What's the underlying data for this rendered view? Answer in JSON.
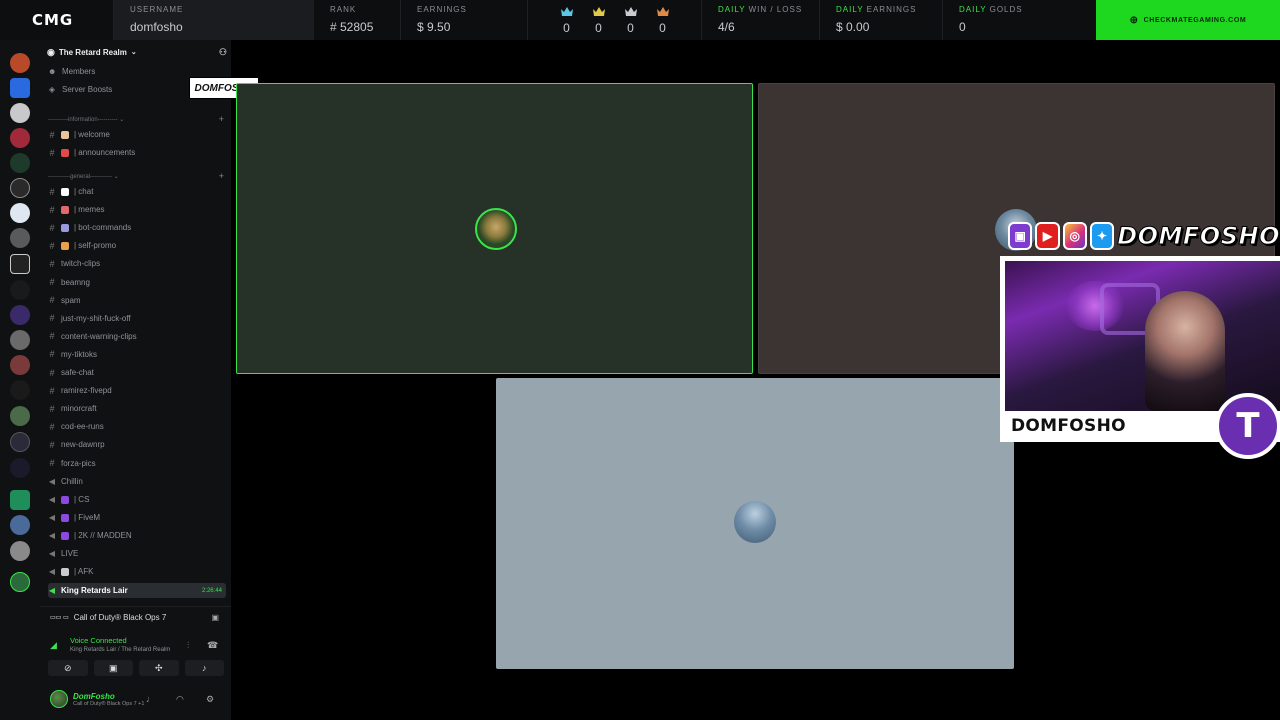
{
  "topbar": {
    "logo": "CMG",
    "username_label": "USERNAME",
    "username": "domfosho",
    "rank_label": "RANK",
    "rank": "# 52805",
    "earnings_label": "EARNINGS",
    "earnings": "$ 9.50",
    "crowns": [
      {
        "color": "#5cc6e6",
        "count": "0"
      },
      {
        "color": "#e2c84a",
        "count": "0"
      },
      {
        "color": "#c9ccd0",
        "count": "0"
      },
      {
        "color": "#e08a4a",
        "count": "0"
      }
    ],
    "daily_wl_label_1": "DAILY",
    "daily_wl_label_2": " WIN / LOSS",
    "daily_wl": "4/6",
    "daily_earnings_label_1": "DAILY",
    "daily_earnings_label_2": " EARNINGS",
    "daily_earnings": "$ 0.00",
    "daily_golds_label_1": "DAILY",
    "daily_golds_label_2": " GOLDS",
    "daily_golds": "0",
    "site_button": "CHECKMATEGAMING.COM"
  },
  "server": {
    "name": "The Retard Realm",
    "members": "Members",
    "boosts": "Server Boosts",
    "category_info": "----------information---------- ⌄",
    "category_general": "-----------general----------- ⌄",
    "channels_info": [
      {
        "name": "| welcome",
        "emoji_color": "#e8c49a"
      },
      {
        "name": "| announcements",
        "emoji_color": "#e04a4a"
      }
    ],
    "channels_general": [
      {
        "name": "| chat",
        "emoji_color": "#ffffff",
        "type": "text"
      },
      {
        "name": "| memes",
        "emoji_color": "#e06a6a",
        "type": "text"
      },
      {
        "name": "| bot-commands",
        "emoji_color": "#9a9ae0",
        "type": "text"
      },
      {
        "name": "| self-promo",
        "emoji_color": "#e8a04a",
        "type": "text"
      },
      {
        "name": "twitch-clips",
        "type": "text"
      },
      {
        "name": "beamng",
        "type": "text"
      },
      {
        "name": "spam",
        "type": "text"
      },
      {
        "name": "just-my-shit-fuck-off",
        "type": "text"
      },
      {
        "name": "content-warning-clips",
        "type": "text"
      },
      {
        "name": "my-tiktoks",
        "type": "text"
      },
      {
        "name": "safe-chat",
        "type": "text"
      },
      {
        "name": "ramirez-fivepd",
        "type": "text"
      },
      {
        "name": "minorcraft",
        "type": "text"
      },
      {
        "name": "cod-ee-runs",
        "type": "text"
      },
      {
        "name": "new-dawnrp",
        "type": "text"
      },
      {
        "name": "forza-pics",
        "type": "text"
      }
    ],
    "voice_channels": [
      {
        "name": "Chillin",
        "emoji_color": ""
      },
      {
        "name": "| CS",
        "emoji_color": "#8a4ae0"
      },
      {
        "name": "| FiveM",
        "emoji_color": "#8a4ae0"
      },
      {
        "name": "| 2K // MADDEN",
        "emoji_color": "#8a4ae0"
      },
      {
        "name": "LIVE",
        "emoji_color": ""
      },
      {
        "name": "| AFK",
        "emoji_color": "#cccccc"
      }
    ],
    "active_voice": {
      "name": "King Retards Lair",
      "time": "2:26:44"
    }
  },
  "stream_tag": "DOMFOSHO",
  "activity": {
    "controller": "▭▭ ▭",
    "game": "Call of Duty® Black Ops 7"
  },
  "voice_status": {
    "title": "Voice Connected",
    "location": "King Retards Lair / The Retard Realm"
  },
  "user": {
    "name": "DomFosho",
    "status": "Call of Duty® Black Ops 7 +1"
  },
  "overlay": {
    "handle": "DOMFOSHO",
    "cam_name": "DOMFOSHO",
    "logo_letter": "T",
    "icons": [
      "twitch-icon",
      "youtube-icon",
      "instagram-icon",
      "twitter-icon"
    ]
  }
}
